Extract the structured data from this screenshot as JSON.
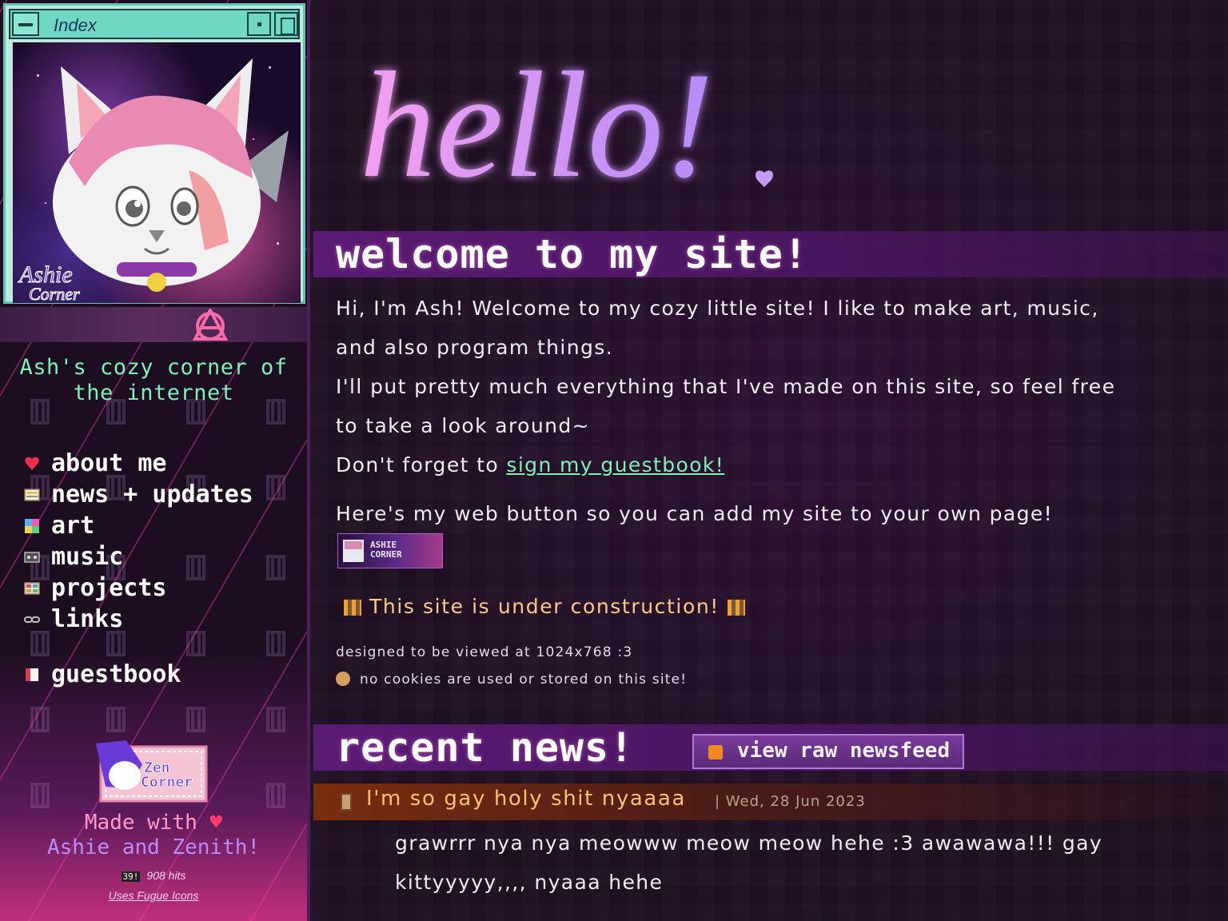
{
  "window": {
    "title": "Index",
    "avatar_alt": "Ashie Corner"
  },
  "sidebar": {
    "site_title_line1": "Ash's cozy corner of",
    "site_title_line2": "the internet",
    "nav": [
      {
        "label": "about me",
        "icon": "heart-icon",
        "color": "#e8314f"
      },
      {
        "label": "news + updates",
        "icon": "newspaper-icon",
        "color": "#e8c060"
      },
      {
        "label": "art",
        "icon": "palette-icon",
        "color": "#5ab0f0"
      },
      {
        "label": "music",
        "icon": "cassette-icon",
        "color": "#b0b0b0"
      },
      {
        "label": "projects",
        "icon": "grid-icon",
        "color": "#d0a070"
      },
      {
        "label": "links",
        "icon": "chain-link-icon",
        "color": "#c0c0c0"
      },
      {
        "label": "guestbook",
        "icon": "book-icon",
        "color": "#d04050"
      }
    ],
    "friend_badge": {
      "line1": "Zen",
      "line2": "Corner"
    },
    "made_with_prefix": "Made with",
    "heart": "♥",
    "made_with_names": "Ashie and Zenith!",
    "hit_counter": "39!",
    "hits": "908 hits",
    "fugue": "Uses Fugue Icons"
  },
  "main": {
    "hello": "hello!",
    "welcome_heading": "welcome to my site!",
    "intro_line1": "Hi, I'm Ash! Welcome to my cozy little site! I like to make art, music,",
    "intro_line2": "and also program things.",
    "intro_line3": "I'll put pretty much everything that I've made on this site, so feel free",
    "intro_line4": "to take a look around~",
    "guestbook_prefix": "Don't forget to ",
    "guestbook_link": "sign my guestbook!",
    "web_button_text": "Here's my web button so you can add my site to your own page!",
    "web_button_label1": "ASHIE",
    "web_button_label2": "CORNER",
    "construction": "This site is under construction!",
    "viewed_at": "designed to be viewed at 1024x768 :3",
    "cookies": "no cookies are used or stored on this site!",
    "news_heading": "recent news!",
    "rss_label": "view raw newsfeed",
    "news": {
      "title": "I'm so gay holy shit nyaaaa",
      "date": "| Wed, 28 Jun 2023",
      "body": "grawrrr nya nya meowww meow meow hehe :3 awawawa!!! gay kittyyyyy,,,, nyaaa hehe"
    }
  },
  "colors": {
    "accent_green": "#7ef0b8",
    "heading_purple": "#5b1b73",
    "news_orange": "#ffc170",
    "hello_pink": "#f3a0f0",
    "hello_violet": "#b48cf8"
  }
}
